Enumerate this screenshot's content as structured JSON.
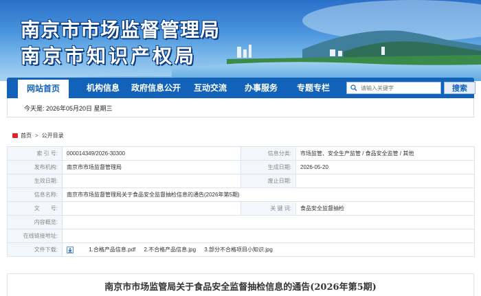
{
  "header": {
    "title_line1": "南京市市场监督管理局",
    "title_line2": "南京市知识产权局"
  },
  "nav": {
    "items": [
      {
        "label": "网站首页",
        "active": true
      },
      {
        "label": "机构信息",
        "active": false
      },
      {
        "label": "政府信息公开",
        "active": false
      },
      {
        "label": "互动交流",
        "active": false
      },
      {
        "label": "办事服务",
        "active": false
      },
      {
        "label": "专题专栏",
        "active": false
      }
    ],
    "search_placeholder": "请输入关键字",
    "search_button": "搜索"
  },
  "datebar": {
    "text": "今天是: 2026年05月20日 星期三"
  },
  "breadcrumb": {
    "home": "首页",
    "separator": ">",
    "current": "公开目录"
  },
  "info": {
    "index_label": "索 引 号:",
    "index_value": "000014349/2026-30300",
    "category_label": "信息分类:",
    "category_value": "市场监管、安全生产监管 / 食品安全监管 / 其他",
    "publisher_label": "发布机构:",
    "publisher_value": "南京市市场监督管理局",
    "created_label": "生成日期:",
    "created_value": "2026-05-20",
    "effective_label": "生效日期:",
    "effective_value": "",
    "repeal_label": "废止日期:",
    "repeal_value": "",
    "name_label": "信息名称:",
    "name_value": "南京市市场监督管理局关于食品安全监督抽检信息的通告(2026年第5期)",
    "docno_label": "文　　号:",
    "docno_value": "",
    "keywords_label": "关 键 词:",
    "keywords_value": "食品安全监督抽检",
    "summary_label": "内容概览:",
    "summary_value": "",
    "link_label": "在线链接地址:",
    "link_value": "",
    "download_label": "文件下载:",
    "attachments": [
      "1.合格产品信息.pdf",
      "2.不合格产品信息.jpg",
      "3.部分不合格项目小知识.jpg"
    ]
  },
  "article": {
    "title": "南京市市场监管局关于食品安全监督抽检信息的通告(2026年第5期)"
  },
  "colors": {
    "nav_blue": "#1162b8",
    "home_icon_red": "#d9262c",
    "label_bg": "#f3f7fb"
  }
}
